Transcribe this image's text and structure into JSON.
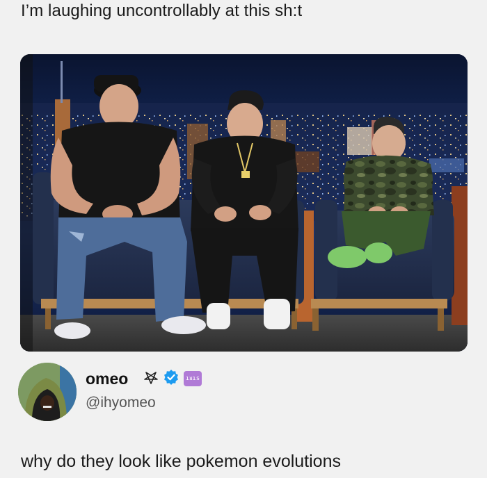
{
  "post": {
    "top_caption": "I’m laughing uncontrollably at this sh:t",
    "bottom_caption": "why do they look like pokemon evolutions"
  },
  "author": {
    "display_name": "omeo",
    "handle": "@ihyomeo",
    "badge_text": "ıᴚıs"
  },
  "icons": [
    "pentagram-icon",
    "verified-badge-icon",
    "iris-badge-icon",
    "avatar-hooded-figure"
  ],
  "colors": {
    "background": "#f1f1f1",
    "verified_blue": "#1d9bf0",
    "iris_badge": "#b07ad6"
  }
}
